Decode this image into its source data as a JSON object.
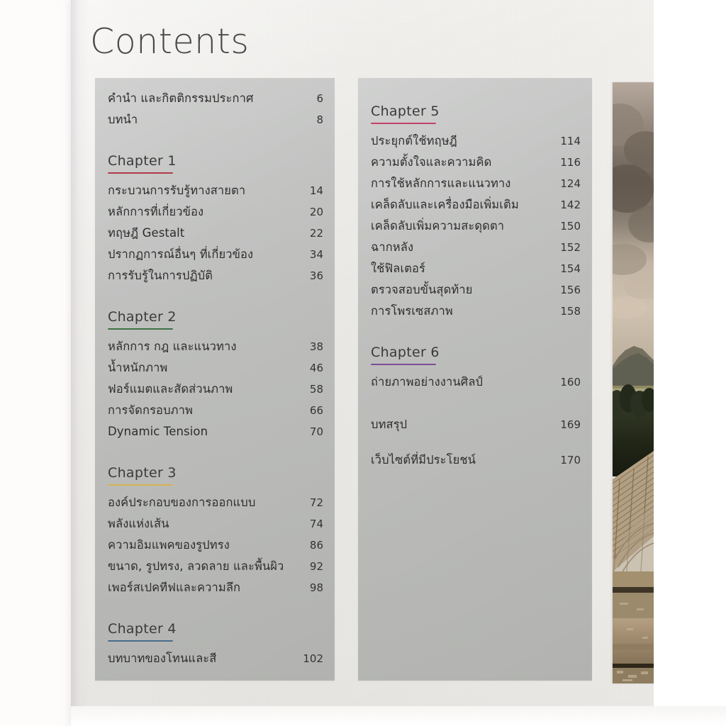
{
  "page": {
    "title": "Contents",
    "photo": {
      "name": "ancient-amphitheatre-photograph",
      "sky_top": "#b9aa9e",
      "sky_cloud_dark": "#6e6257",
      "sky_light": "#cdbfb0",
      "mountain": "#5c5d52",
      "trees": "#262a1d",
      "stone_light": "#b9a488",
      "stone_mid": "#9a8468",
      "stone_dark": "#6b5942"
    }
  },
  "columns": [
    {
      "name": "left-column",
      "front_matter": [
        {
          "label": "คำนำ และกิตติกรรมประกาศ",
          "page": "6"
        },
        {
          "label": "บทนำ",
          "page": "8"
        }
      ],
      "chapters": [
        {
          "heading": "Chapter  1",
          "rule_color": "#b03a4a",
          "entries": [
            {
              "label": "กระบวนการรับรู้ทางสายตา",
              "page": "14"
            },
            {
              "label": "หลักการที่เกี่ยวข้อง",
              "page": "20"
            },
            {
              "label": "ทฤษฎี Gestalt",
              "page": "22"
            },
            {
              "label": "ปรากฏการณ์อื่นๆ ที่เกี่ยวข้อง",
              "page": "34"
            },
            {
              "label": "การรับรู้ในการปฏิบัติ",
              "page": "36"
            }
          ]
        },
        {
          "heading": "Chapter  2",
          "rule_color": "#3f7244",
          "entries": [
            {
              "label": "หลักการ กฎ และแนวทาง",
              "page": "38"
            },
            {
              "label": "น้ำหนักภาพ",
              "page": "46"
            },
            {
              "label": "ฟอร์แมตและสัดส่วนภาพ",
              "page": "58"
            },
            {
              "label": "การจัดกรอบภาพ",
              "page": "66"
            },
            {
              "label": "Dynamic Tension",
              "page": "70"
            }
          ]
        },
        {
          "heading": "Chapter  3",
          "rule_color": "#d8b255",
          "entries": [
            {
              "label": "องค์ประกอบของการออกแบบ",
              "page": "72"
            },
            {
              "label": "พลังแห่งเส้น",
              "page": "74"
            },
            {
              "label": "ความอิมแพคของรูปทรง",
              "page": "86"
            },
            {
              "label": "ขนาด, รูปทรง, ลวดลาย และพื้นผิว",
              "page": "92"
            },
            {
              "label": "เพอร์สเปคทีฟและความลึก",
              "page": "98"
            }
          ]
        },
        {
          "heading": "Chapter  4",
          "rule_color": "#4a6b8a",
          "entries": [
            {
              "label": "บทบาทของโทนและสี",
              "page": "102"
            }
          ]
        }
      ]
    },
    {
      "name": "right-column",
      "front_matter": [],
      "chapters": [
        {
          "heading": "Chapter  5",
          "rule_color": "#c2416b",
          "entries": [
            {
              "label": "ประยุกต์ใช้ทฤษฎี",
              "page": "114"
            },
            {
              "label": "ความตั้งใจและความคิด",
              "page": "116"
            },
            {
              "label": "การใช้หลักการและแนวทาง",
              "page": "124"
            },
            {
              "label": "เคล็ดลับและเครื่องมือเพิ่มเติม",
              "page": "142"
            },
            {
              "label": "เคล็ดลับเพิ่มความสะดุดตา",
              "page": "150"
            },
            {
              "label": "ฉากหลัง",
              "page": "152"
            },
            {
              "label": "ใช้ฟิลเตอร์",
              "page": "154"
            },
            {
              "label": "ตรวจสอบขั้นสุดท้าย",
              "page": "156"
            },
            {
              "label": "การโพรเซสภาพ",
              "page": "158"
            }
          ]
        },
        {
          "heading": "Chapter  6",
          "rule_color": "#7d4d93",
          "entries": [
            {
              "label": "ถ่ายภาพอย่างงานศิลป์",
              "page": "160"
            }
          ]
        }
      ],
      "back_matter": [
        {
          "label": "บทสรุป",
          "page": "169"
        },
        {
          "label": "เว็บไซต์ที่มีประโยชน์",
          "page": "170"
        }
      ]
    }
  ]
}
